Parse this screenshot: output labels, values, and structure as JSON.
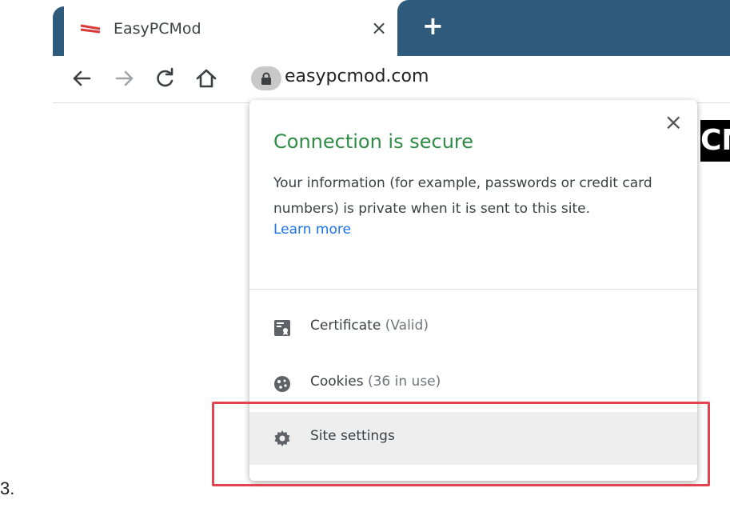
{
  "tab": {
    "title": "EasyPCMod",
    "close_glyph": "×",
    "new_tab_glyph": "+"
  },
  "toolbar": {
    "url": "easypcmod.com"
  },
  "page": {
    "logo_text": "CM"
  },
  "popup": {
    "close_glyph": "×",
    "title": "Connection is secure",
    "description": "Your information (for example, passwords or credit card numbers) is private when it is sent to this site.",
    "learn_more": "Learn more",
    "rows": [
      {
        "label": "Certificate",
        "detail": "(Valid)",
        "icon": "certificate-icon"
      },
      {
        "label": "Cookies",
        "detail": "(36 in use)",
        "icon": "cookie-icon"
      },
      {
        "label": "Site settings",
        "detail": "",
        "icon": "gear-icon"
      }
    ]
  },
  "caption": {
    "step": "3."
  },
  "colors": {
    "tabstrip": "#2e5a7c",
    "secure_green": "#2e8b43",
    "link_blue": "#1a73e8",
    "highlight_red": "#e0444e"
  }
}
